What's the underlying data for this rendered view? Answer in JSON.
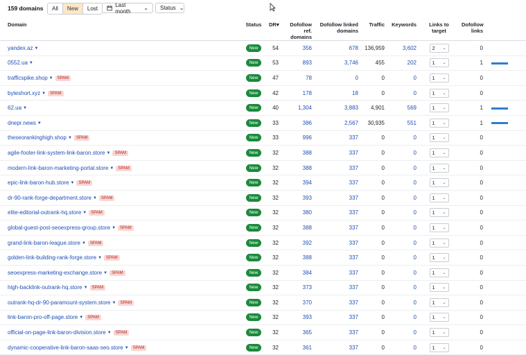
{
  "header": {
    "domain_count": "159 domains",
    "filter_tabs": [
      {
        "label": "All",
        "active": false
      },
      {
        "label": "New",
        "active": true
      },
      {
        "label": "Lost",
        "active": false
      }
    ],
    "date_filter_label": "Last month",
    "status_filter_label": "Status"
  },
  "table": {
    "columns": {
      "domain": "Domain",
      "status": "Status",
      "dr": "DR",
      "dofollow_ref_domains": "Dofollow ref. domains",
      "dofollow_linked_domains": "Dofollow linked domains",
      "traffic": "Traffic",
      "keywords": "Keywords",
      "links_to_target": "Links to target",
      "dofollow_links": "Dofollow links"
    },
    "sort_indicator": "▾",
    "status_label": "New",
    "spam_label": "SPAM",
    "accent_color": "#2e7bd3",
    "badge_color": "#1a8a3b",
    "rows": [
      {
        "domain": "yandex.az",
        "spam": false,
        "dr": "54",
        "ref": "356",
        "linked": "678",
        "traffic": "136,959",
        "keywords": "3,602",
        "links": "2",
        "dofollow": "0",
        "bar": 0
      },
      {
        "domain": "0552.ua",
        "spam": false,
        "dr": "53",
        "ref": "893",
        "linked": "3,746",
        "traffic": "455",
        "keywords": "202",
        "links": "1",
        "dofollow": "1",
        "bar": 1
      },
      {
        "domain": "trafficspike.shop",
        "spam": true,
        "dr": "47",
        "ref": "78",
        "linked": "0",
        "traffic": "0",
        "keywords": "0",
        "links": "1",
        "dofollow": "0",
        "bar": 0
      },
      {
        "domain": "byteshort.xyz",
        "spam": true,
        "dr": "42",
        "ref": "178",
        "linked": "18",
        "traffic": "0",
        "keywords": "0",
        "links": "1",
        "dofollow": "0",
        "bar": 0
      },
      {
        "domain": "62.ua",
        "spam": false,
        "dr": "40",
        "ref": "1,304",
        "linked": "3,883",
        "traffic": "4,901",
        "keywords": "569",
        "links": "1",
        "dofollow": "1",
        "bar": 1
      },
      {
        "domain": "dnepr.news",
        "spam": false,
        "dr": "33",
        "ref": "386",
        "linked": "2,567",
        "traffic": "30,935",
        "keywords": "551",
        "links": "1",
        "dofollow": "1",
        "bar": 1
      },
      {
        "domain": "theseorankinghigh.shop",
        "spam": true,
        "dr": "33",
        "ref": "996",
        "linked": "337",
        "traffic": "0",
        "keywords": "0",
        "links": "1",
        "dofollow": "0",
        "bar": 0
      },
      {
        "domain": "agile-footer-link-system-link-baron.store",
        "spam": true,
        "dr": "32",
        "ref": "388",
        "linked": "337",
        "traffic": "0",
        "keywords": "0",
        "links": "1",
        "dofollow": "0",
        "bar": 0
      },
      {
        "domain": "modern-link-baron-marketing-portal.store",
        "spam": true,
        "dr": "32",
        "ref": "388",
        "linked": "337",
        "traffic": "0",
        "keywords": "0",
        "links": "1",
        "dofollow": "0",
        "bar": 0
      },
      {
        "domain": "epic-link-baron-hub.store",
        "spam": true,
        "dr": "32",
        "ref": "394",
        "linked": "337",
        "traffic": "0",
        "keywords": "0",
        "links": "1",
        "dofollow": "0",
        "bar": 0
      },
      {
        "domain": "dr-90-rank-forge-department.store",
        "spam": true,
        "dr": "32",
        "ref": "393",
        "linked": "337",
        "traffic": "0",
        "keywords": "0",
        "links": "1",
        "dofollow": "0",
        "bar": 0
      },
      {
        "domain": "elite-editorial-outrank-hq.store",
        "spam": true,
        "dr": "32",
        "ref": "380",
        "linked": "337",
        "traffic": "0",
        "keywords": "0",
        "links": "1",
        "dofollow": "0",
        "bar": 0
      },
      {
        "domain": "global-guest-post-seoexpress-group.store",
        "spam": true,
        "dr": "32",
        "ref": "388",
        "linked": "337",
        "traffic": "0",
        "keywords": "0",
        "links": "1",
        "dofollow": "0",
        "bar": 0
      },
      {
        "domain": "grand-link-baron-league.store",
        "spam": true,
        "dr": "32",
        "ref": "392",
        "linked": "337",
        "traffic": "0",
        "keywords": "0",
        "links": "1",
        "dofollow": "0",
        "bar": 0
      },
      {
        "domain": "golden-link-building-rank-forge.store",
        "spam": true,
        "dr": "32",
        "ref": "388",
        "linked": "337",
        "traffic": "0",
        "keywords": "0",
        "links": "1",
        "dofollow": "0",
        "bar": 0
      },
      {
        "domain": "seoexpress-marketing-exchange.store",
        "spam": true,
        "dr": "32",
        "ref": "384",
        "linked": "337",
        "traffic": "0",
        "keywords": "0",
        "links": "1",
        "dofollow": "0",
        "bar": 0
      },
      {
        "domain": "high-backlink-outrank-hq.store",
        "spam": true,
        "dr": "32",
        "ref": "373",
        "linked": "337",
        "traffic": "0",
        "keywords": "0",
        "links": "1",
        "dofollow": "0",
        "bar": 0
      },
      {
        "domain": "outrank-hq-dr-90-paramount-system.store",
        "spam": true,
        "dr": "32",
        "ref": "370",
        "linked": "337",
        "traffic": "0",
        "keywords": "0",
        "links": "1",
        "dofollow": "0",
        "bar": 0
      },
      {
        "domain": "link-baron-pro-off-page.store",
        "spam": true,
        "dr": "32",
        "ref": "393",
        "linked": "337",
        "traffic": "0",
        "keywords": "0",
        "links": "1",
        "dofollow": "0",
        "bar": 0
      },
      {
        "domain": "official-on-page-link-baron-division.store",
        "spam": true,
        "dr": "32",
        "ref": "365",
        "linked": "337",
        "traffic": "0",
        "keywords": "0",
        "links": "1",
        "dofollow": "0",
        "bar": 0
      },
      {
        "domain": "dynamic-cooperative-link-baron-saas-seo.store",
        "spam": true,
        "dr": "32",
        "ref": "361",
        "linked": "337",
        "traffic": "0",
        "keywords": "0",
        "links": "1",
        "dofollow": "0",
        "bar": 0
      }
    ]
  }
}
